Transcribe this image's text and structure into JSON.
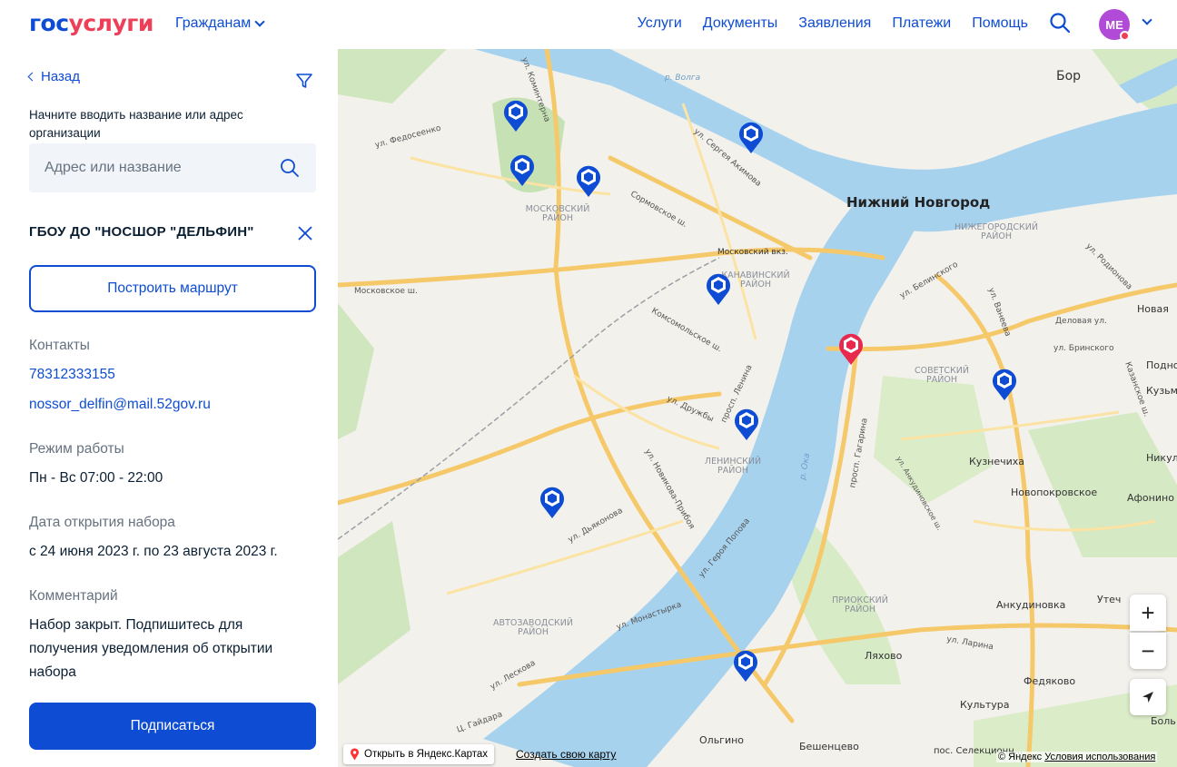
{
  "header": {
    "logo_part1": "гос",
    "logo_part2": "услуги",
    "audience": "Гражданам",
    "nav": [
      "Услуги",
      "Документы",
      "Заявления",
      "Платежи",
      "Помощь"
    ],
    "avatar_initials": "МЕ",
    "colors": {
      "brand_blue": "#0d4cd3",
      "brand_red": "#ee3f58",
      "avatar": "#b04ad7"
    }
  },
  "sidebar": {
    "back_label": "Назад",
    "hint": "Начните вводить название или адрес организации",
    "search_placeholder": "Адрес или название",
    "org_title": "ГБОУ ДО \"НОСШОР \"ДЕЛЬФИН\"",
    "route_button": "Построить маршрут",
    "contacts_label": "Контакты",
    "phone": "78312333155",
    "email": "nossor_delfin@mail.52gov.ru",
    "hours_label": "Режим работы",
    "hours": "Пн - Вс 07:00 - 22:00",
    "enrollment_label": "Дата открытия набора",
    "enrollment": "с 24 июня 2023 г. по 23 августа 2023 г.",
    "comment_label": "Комментарий",
    "comment": "Набор закрыт. Подпишитесь для получения уведомления об открытии набора",
    "subscribe_button": "Подписаться"
  },
  "map": {
    "city_label": "Нижний Новгород",
    "districts": [
      "МОСКОВСКИЙ РАЙОН",
      "КАНАВИНСКИЙ РАЙОН",
      "НИЖЕГОРОДСКИЙ РАЙОН",
      "СОВЕТСКИЙ РАЙОН",
      "ЛЕНИНСКИЙ РАЙОН",
      "АВТОЗАВОДСКИЙ РАЙОН",
      "ПРИОКСКИЙ РАЙОН"
    ],
    "places": [
      "Бор",
      "Новая",
      "Подно",
      "Кузьми",
      "Кузнечиха",
      "Никул",
      "Новопокровское",
      "Афонино",
      "Анкудиновка",
      "Утеч",
      "Ляхово",
      "Федяково",
      "Культура",
      "Боль",
      "Ольгино",
      "Бешенцево",
      "пос. Селекционн...",
      "Московский вкз."
    ],
    "streets": [
      "ул. Коминтерна",
      "ул. Федосеенко",
      "Сормовское ш.",
      "ул. Сергея Акимова",
      "Московское ш.",
      "Комсомольское ш.",
      "просп. Ленина",
      "ул. Дружбы",
      "ул. Новикова-Прибоя",
      "ул. Дьяконова",
      "ул. Героя Попова",
      "ул. Монастырка",
      "ул. Лескова",
      "просп. Гагарина",
      "ул. Ларина",
      "ул. Белинского",
      "ул. Ванеева",
      "ул. Родионова",
      "Деловая ул.",
      "ул. Бринского",
      "Казанское ш.",
      "р. Волга",
      "р. Ока",
      "ул. Анкудиновское ш.",
      "Ц. Гайдара"
    ],
    "zoom_in": "+",
    "zoom_out": "−",
    "open_in_yandex": "Открыть в Яндекс.Картах",
    "create_map": "Создать свою карту",
    "copyright": "© Яндекс",
    "terms": "Условия использования",
    "pin_colors": {
      "default": "#0d4cd3",
      "selected": "#e8294e"
    }
  }
}
